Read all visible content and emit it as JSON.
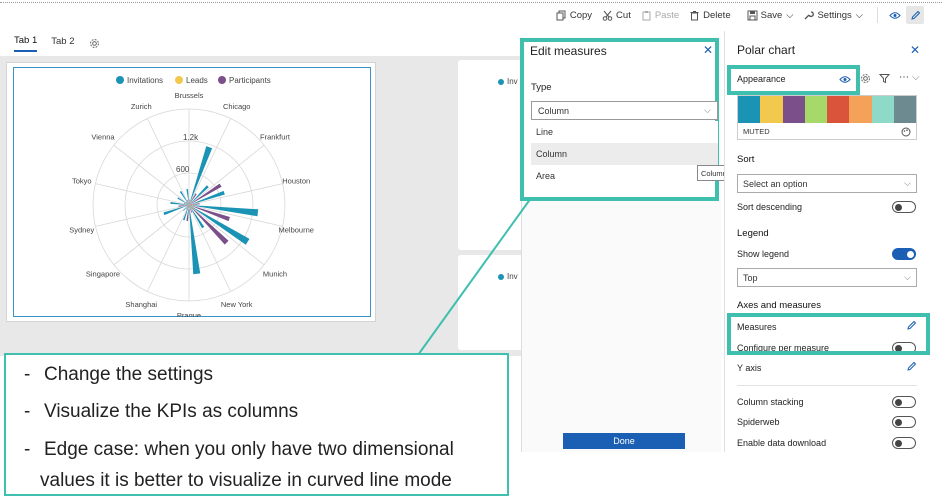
{
  "toolbar": {
    "copy": "Copy",
    "cut": "Cut",
    "paste": "Paste",
    "delete": "Delete",
    "save": "Save",
    "settings": "Settings"
  },
  "tabs": [
    {
      "label": "Tab 1",
      "active": true
    },
    {
      "label": "Tab 2",
      "active": false
    }
  ],
  "chart": {
    "legend": [
      "Invitations",
      "Leads",
      "Participants"
    ],
    "legend_colors": [
      "#1a93b5",
      "#f2c94c",
      "#7b4f8a"
    ],
    "tick_labels": [
      "1.2k",
      "600"
    ],
    "ghost_legend": [
      "Inv",
      "Inv"
    ]
  },
  "chart_data": {
    "type": "bar",
    "subtype": "polar",
    "categories": [
      "Brussels",
      "Chicago",
      "Frankfurt",
      "Houston",
      "Melbourne",
      "Munich",
      "New York",
      "Prague",
      "Shanghai",
      "Singapore",
      "Sydney",
      "Tokyo",
      "Vienna",
      "Zurich"
    ],
    "series": [
      {
        "name": "Invitations",
        "color": "#1a93b5",
        "values": [
          300,
          1150,
          500,
          700,
          1300,
          1300,
          500,
          1300,
          300,
          150,
          500,
          350,
          250,
          300
        ]
      },
      {
        "name": "Leads",
        "color": "#f2c94c",
        "values": [
          50,
          100,
          60,
          80,
          100,
          120,
          80,
          80,
          40,
          40,
          60,
          50,
          40,
          40
        ]
      },
      {
        "name": "Participants",
        "color": "#7b4f8a",
        "values": [
          100,
          250,
          700,
          200,
          800,
          1000,
          150,
          300,
          100,
          50,
          200,
          100,
          80,
          100
        ]
      }
    ],
    "ylim": [
      0,
      1800
    ],
    "ticks": [
      600,
      1200
    ]
  },
  "edit_measures": {
    "title": "Edit measures",
    "type_label": "Type",
    "selected": "Column",
    "options": [
      "Line",
      "Column",
      "Area"
    ],
    "tooltip": "Column",
    "done": "Done"
  },
  "right_pane": {
    "title": "Polar chart",
    "appearance": "Appearance",
    "palette_name": "MUTED",
    "palette": [
      "#1a93b5",
      "#f2c94c",
      "#7b4f8a",
      "#a6d96a",
      "#d9543a",
      "#f4a259",
      "#8fd9c9",
      "#6d8a91"
    ],
    "sort_heading": "Sort",
    "sort_placeholder": "Select an option",
    "sort_descending": "Sort descending",
    "legend_heading": "Legend",
    "show_legend": "Show legend",
    "legend_position": "Top",
    "axes_heading": "Axes and measures",
    "measures": "Measures",
    "configure_per_measure": "Configure per measure",
    "y_axis": "Y axis",
    "column_stacking": "Column stacking",
    "spiderweb": "Spiderweb",
    "enable_download": "Enable data download"
  },
  "callout": {
    "line1": "Change the settings",
    "line2": "Visualize the KPIs as columns",
    "line3a": "Edge case: when you only have two dimensional",
    "line3b": "values it is better to visualize in curved line mode"
  },
  "colors": {
    "accent": "#1a5fb4",
    "highlight": "#3fbfae"
  }
}
